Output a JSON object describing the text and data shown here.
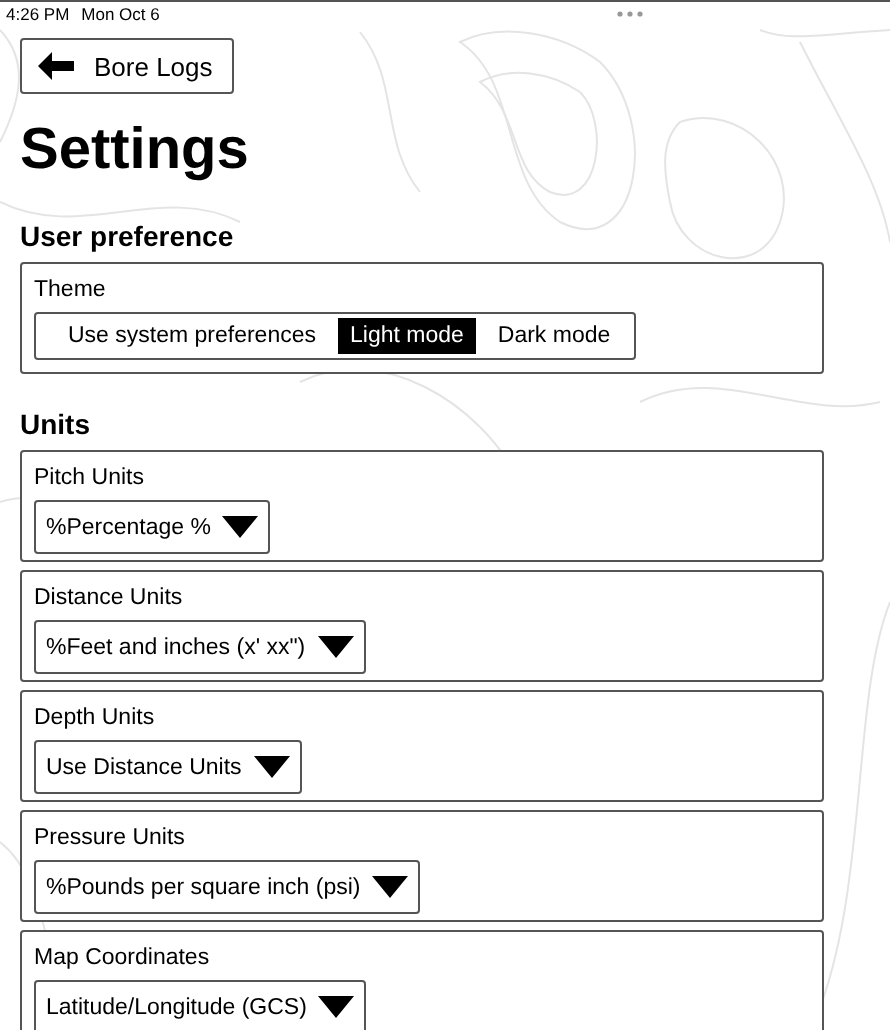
{
  "status_bar": {
    "time": "4:26 PM",
    "date": "Mon Oct 6"
  },
  "back_button": {
    "label": "Bore Logs"
  },
  "title": "Settings",
  "sections": [
    {
      "heading": "User preference",
      "settings": [
        {
          "kind": "segmented",
          "label": "Theme",
          "options": [
            {
              "label": "Use system preferences",
              "selected": false
            },
            {
              "label": "Light mode",
              "selected": true
            },
            {
              "label": "Dark mode",
              "selected": false
            }
          ]
        }
      ]
    },
    {
      "heading": "Units",
      "settings": [
        {
          "kind": "dropdown",
          "label": "Pitch Units",
          "value": "%Percentage %"
        },
        {
          "kind": "dropdown",
          "label": "Distance Units",
          "value": "%Feet and inches (x' xx\")"
        },
        {
          "kind": "dropdown",
          "label": "Depth Units",
          "value": "Use Distance Units"
        },
        {
          "kind": "dropdown",
          "label": "Pressure Units",
          "value": "%Pounds per square inch (psi)"
        },
        {
          "kind": "dropdown",
          "label": "Map Coordinates",
          "value": "Latitude/Longitude (GCS)"
        }
      ]
    }
  ]
}
